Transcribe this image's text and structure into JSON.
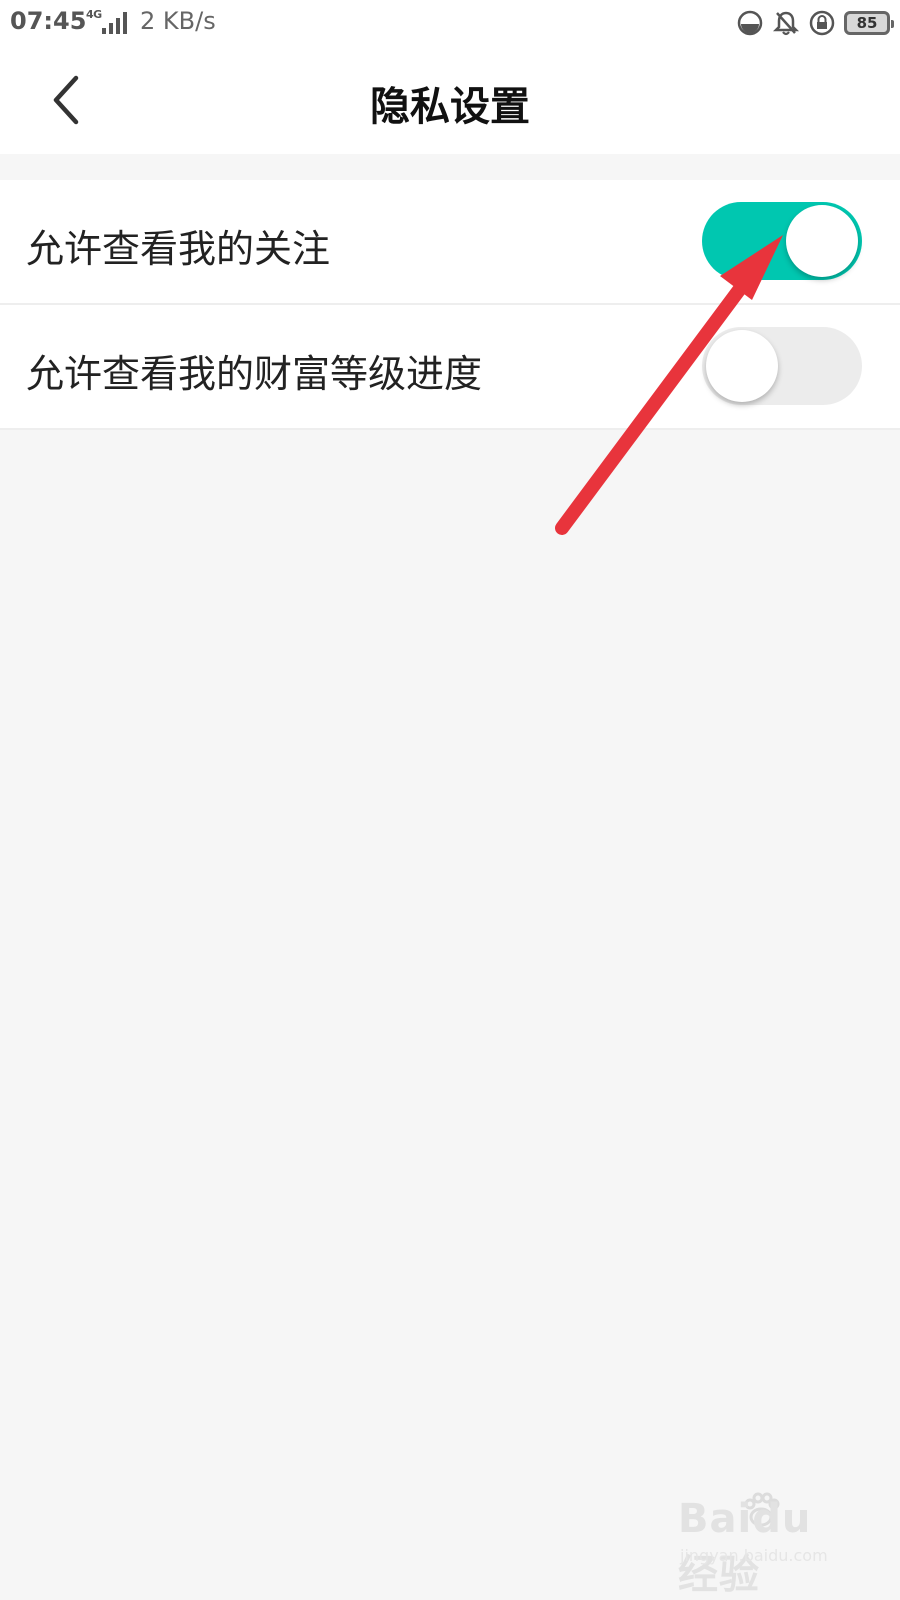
{
  "status_bar": {
    "time": "07:45",
    "network": "4G",
    "speed": "2 KB/s",
    "battery": "85",
    "icons": [
      "data-saver-icon",
      "bell-off-icon",
      "rotation-lock-icon",
      "battery-icon"
    ]
  },
  "header": {
    "back_icon": "chevron-left-icon",
    "title": "隐私设置"
  },
  "settings": {
    "items": [
      {
        "label": "允许查看我的关注",
        "enabled": true
      },
      {
        "label": "允许查看我的财富等级进度",
        "enabled": false
      }
    ]
  },
  "colors": {
    "toggle_on": "#00c7b0",
    "toggle_off": "#ececec",
    "annotation_arrow": "#e8343c",
    "background": "#f6f6f6"
  },
  "watermark": {
    "main": "Baidu经验",
    "sub": "jingyan.baidu.com"
  }
}
